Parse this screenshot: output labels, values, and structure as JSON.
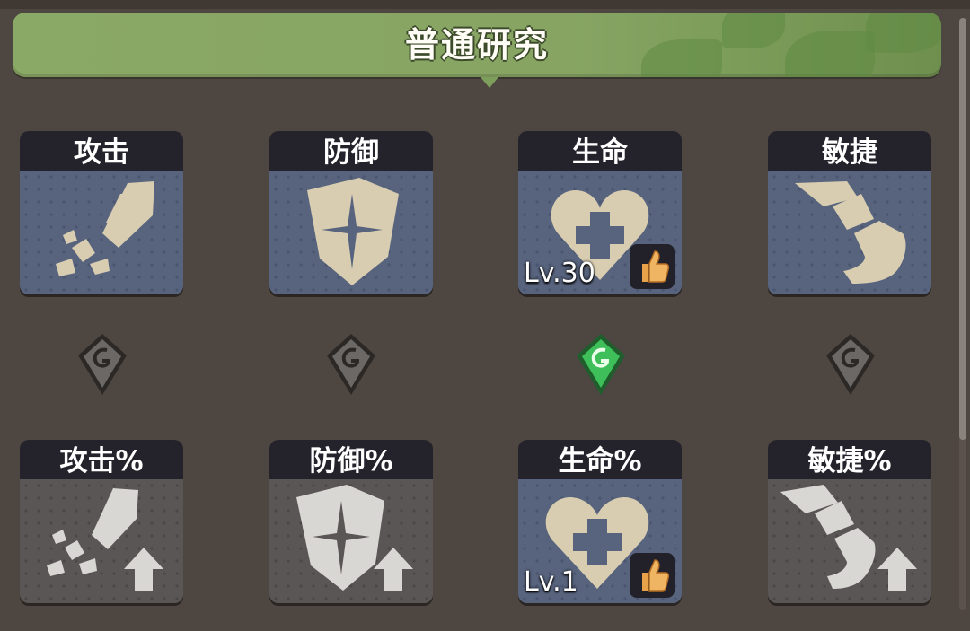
{
  "header": {
    "title": "普通研究"
  },
  "colors": {
    "accent_active": "#3fbf5a",
    "inactive": "#6b6866",
    "banner": "#87a463"
  },
  "rows": [
    {
      "cards": [
        {
          "label": "攻击",
          "icon": "sword-icon",
          "style": "blue"
        },
        {
          "label": "防御",
          "icon": "shield-icon",
          "style": "blue"
        },
        {
          "label": "生命",
          "icon": "heart-icon",
          "style": "blue",
          "level": "Lv.30",
          "recommended": true
        },
        {
          "label": "敏捷",
          "icon": "boot-icon",
          "style": "blue"
        }
      ]
    },
    {
      "cards": [
        {
          "label": "攻击%",
          "icon": "sword-up-icon",
          "style": "gray"
        },
        {
          "label": "防御%",
          "icon": "shield-up-icon",
          "style": "gray"
        },
        {
          "label": "生命%",
          "icon": "heart-icon",
          "style": "blue",
          "level": "Lv.1",
          "recommended": true
        },
        {
          "label": "敏捷%",
          "icon": "boot-up-icon",
          "style": "gray"
        }
      ]
    }
  ],
  "connectors": [
    {
      "icon": "connector-gem-icon",
      "state": "inactive"
    },
    {
      "icon": "connector-gem-icon",
      "state": "inactive"
    },
    {
      "icon": "connector-gem-icon",
      "state": "active"
    },
    {
      "icon": "connector-gem-icon",
      "state": "inactive"
    }
  ]
}
